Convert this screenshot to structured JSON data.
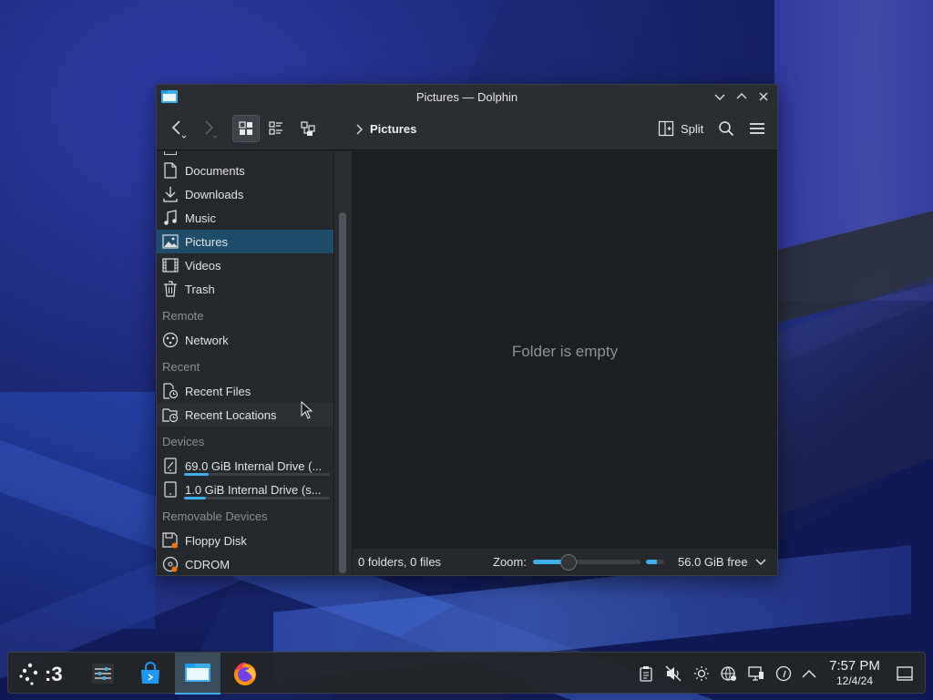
{
  "window": {
    "title": "Pictures — Dolphin"
  },
  "toolbar": {
    "breadcrumb": "Pictures",
    "split_label": "Split"
  },
  "sidebar": {
    "places": [
      {
        "label": "Documents",
        "icon": "document-icon"
      },
      {
        "label": "Downloads",
        "icon": "download-icon"
      },
      {
        "label": "Music",
        "icon": "music-icon"
      },
      {
        "label": "Pictures",
        "icon": "picture-icon",
        "selected": true
      },
      {
        "label": "Videos",
        "icon": "video-icon"
      },
      {
        "label": "Trash",
        "icon": "trash-icon"
      }
    ],
    "remote_heading": "Remote",
    "remote": [
      {
        "label": "Network",
        "icon": "network-icon"
      }
    ],
    "recent_heading": "Recent",
    "recent": [
      {
        "label": "Recent Files",
        "icon": "recent-files-icon"
      },
      {
        "label": "Recent Locations",
        "icon": "recent-locations-icon"
      }
    ],
    "devices_heading": "Devices",
    "devices": [
      {
        "label": "69.0 GiB Internal Drive (...",
        "usage_fraction": 0.17
      },
      {
        "label": "1.0 GiB Internal Drive (s...",
        "usage_fraction": 0.15
      }
    ],
    "removable_heading": "Removable Devices",
    "removable": [
      {
        "label": "Floppy Disk",
        "icon": "floppy-icon"
      },
      {
        "label": "CDROM",
        "icon": "cdrom-icon"
      }
    ]
  },
  "main": {
    "empty_message": "Folder is empty"
  },
  "statusbar": {
    "summary": "0 folders, 0 files",
    "zoom_label": "Zoom:",
    "zoom_fraction": 0.3,
    "free_space": "56.0 GiB free",
    "free_fraction": 0.6
  },
  "taskbar": {
    "desktop_label": ":3",
    "clock_time": "7:57 PM",
    "clock_date": "12/4/24"
  },
  "colors": {
    "accent": "#3daee9",
    "selection": "#1e4d6b",
    "window_bg": "#202326"
  }
}
